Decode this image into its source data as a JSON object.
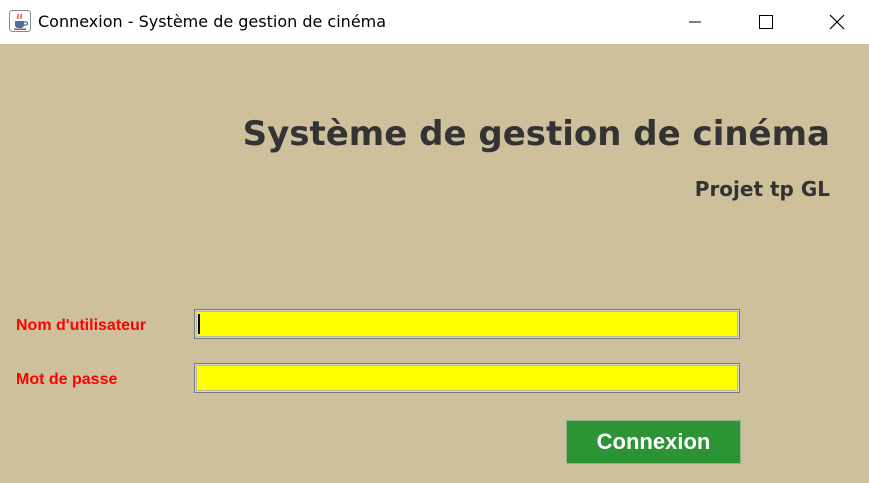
{
  "window": {
    "title": "Connexion - Système de gestion de cinéma",
    "app_icon": "java-cup-icon"
  },
  "main": {
    "heading": "Système de gestion de cinéma",
    "subheading": "Projet tp GL"
  },
  "form": {
    "username_label": "Nom d'utilisateur",
    "username_value": "",
    "password_label": "Mot de passe",
    "password_value": "",
    "submit_label": "Connexion"
  },
  "colors": {
    "background": "#cfc09c",
    "heading": "#333333",
    "label": "#ff0000",
    "field": "#ffff00",
    "button": "#2d9436",
    "button_text": "#ffffff"
  }
}
